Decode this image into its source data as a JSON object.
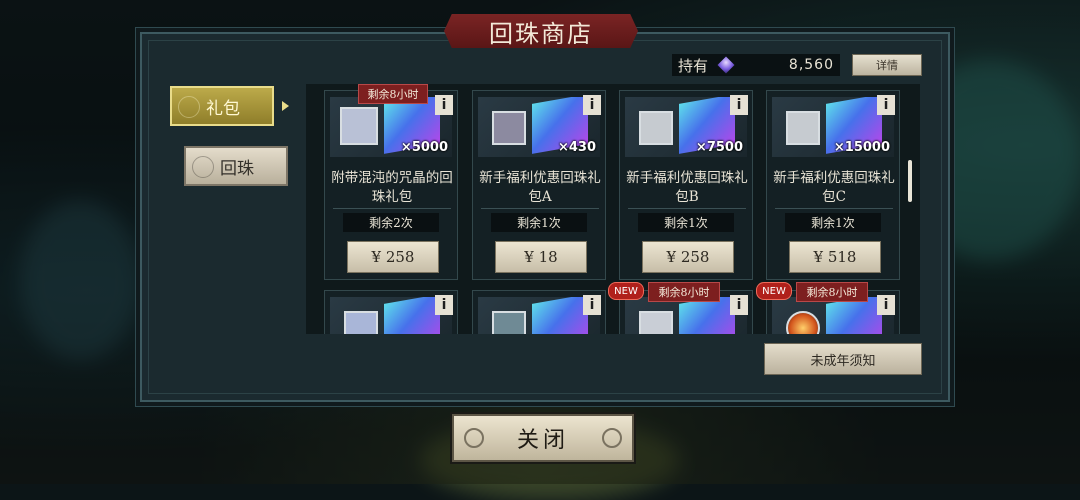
{
  "title": "回珠商店",
  "currency": {
    "label": "持有",
    "icon": "gem-icon",
    "amount": "8,560",
    "detail_label": "详情"
  },
  "tabs": [
    {
      "label": "礼包",
      "active": true
    },
    {
      "label": "回珠",
      "active": false
    }
  ],
  "cards": [
    {
      "name": "附带混沌的咒晶的回珠礼包",
      "qty": "×5000",
      "remain": "剩余2次",
      "price": "¥ 258",
      "badge_time": "剩余8小时",
      "badge_new": ""
    },
    {
      "name": "新手福利优惠回珠礼包A",
      "qty": "×430",
      "remain": "剩余1次",
      "price": "¥ 18",
      "badge_time": "",
      "badge_new": ""
    },
    {
      "name": "新手福利优惠回珠礼包B",
      "qty": "×7500",
      "remain": "剩余1次",
      "price": "¥ 258",
      "badge_time": "",
      "badge_new": ""
    },
    {
      "name": "新手福利优惠回珠礼包C",
      "qty": "×15000",
      "remain": "剩余1次",
      "price": "¥ 518",
      "badge_time": "",
      "badge_new": ""
    },
    {
      "name": "",
      "qty": "",
      "remain": "",
      "price": "",
      "badge_time": "",
      "badge_new": ""
    },
    {
      "name": "",
      "qty": "",
      "remain": "",
      "price": "",
      "badge_time": "",
      "badge_new": ""
    },
    {
      "name": "",
      "qty": "",
      "remain": "",
      "price": "",
      "badge_time": "剩余8小时",
      "badge_new": "NEW"
    },
    {
      "name": "",
      "qty": "",
      "remain": "",
      "price": "",
      "badge_time": "剩余8小时",
      "badge_new": "NEW"
    }
  ],
  "info_label": "i",
  "notice_label": "未成年须知",
  "close_label": "关闭",
  "colors": {
    "accent_gold": "#bcaa4a",
    "banner_red": "#7a2424",
    "panel": "#1b2a2f"
  }
}
